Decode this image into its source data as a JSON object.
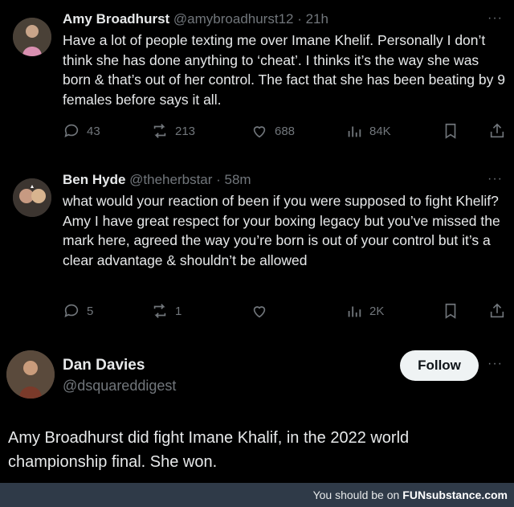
{
  "tweets": [
    {
      "name": "Amy Broadhurst",
      "handle": "@amybroadhurst12 · 21h",
      "text": "Have a lot of people texting me over Imane Khelif. Personally I don’t think she has done anything to ‘cheat’. I thinks it’s the way she was born & that’s out of her control. The fact that she has been beating by 9 females before says it all.",
      "replies": "43",
      "reposts": "213",
      "likes": "688",
      "views": "84K"
    },
    {
      "name": "Ben Hyde",
      "handle": "@theherbstar · 58m",
      "text": "what would your reaction of been if you were supposed to fight Khelif? Amy I have great respect for your boxing legacy but you’ve missed the mark here, agreed the way you’re born is out of your control but it’s a clear advantage & shouldn’t be allowed",
      "replies": "5",
      "reposts": "1",
      "likes": "",
      "views": "2K"
    }
  ],
  "profile": {
    "name": "Dan Davies",
    "handle": "@dsquareddigest",
    "follow_label": "Follow"
  },
  "caption": "Amy Broadhurst  did fight Imane Khalif, in the 2022 world championship final. She won.",
  "footer": {
    "prefix": "You should be on",
    "brand": "FUNsubstance.com"
  }
}
